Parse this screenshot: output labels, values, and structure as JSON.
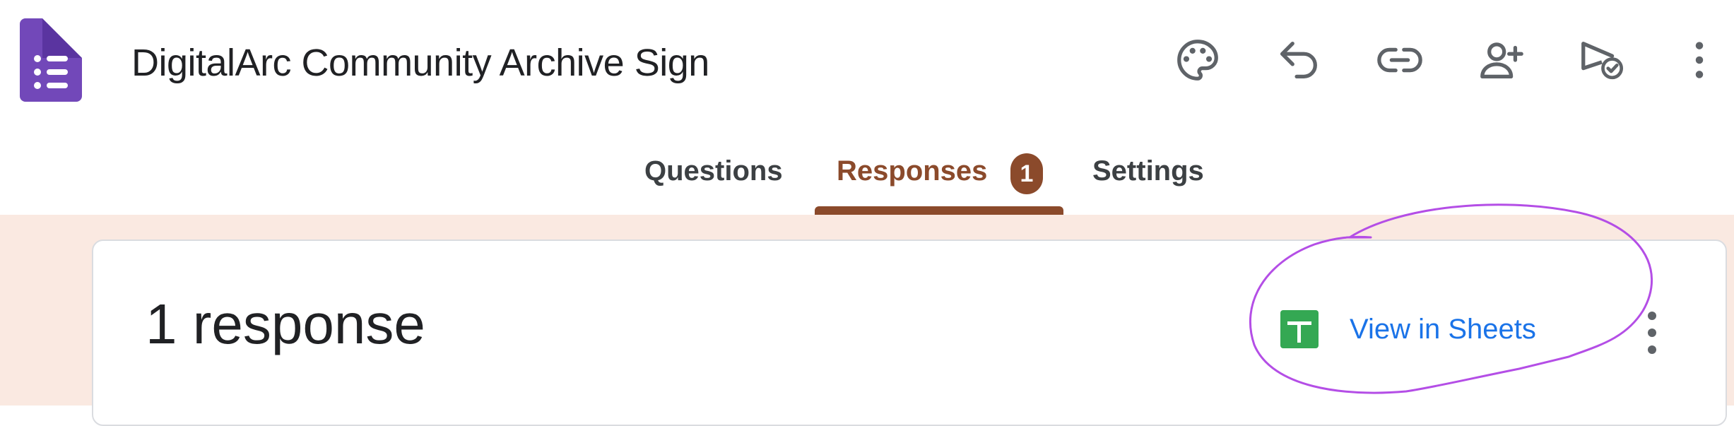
{
  "app": {
    "title": "DigitalArc Community Archive Sign",
    "logo_icon": "google-forms-icon",
    "accent_color": "#7248b9"
  },
  "toolbar": {
    "icons": [
      "palette-icon",
      "undo-icon",
      "link-icon",
      "add-collaborator-icon",
      "send-icon",
      "more-vert-icon"
    ]
  },
  "tabs": [
    {
      "label": "Questions",
      "active": false
    },
    {
      "label": "Responses",
      "active": true,
      "badge": "1"
    },
    {
      "label": "Settings",
      "active": false
    }
  ],
  "responses": {
    "count_label": "1 response",
    "view_in_sheets_label": "View in Sheets",
    "sheets_icon": "google-sheets-icon",
    "menu_icon": "more-vert-icon"
  },
  "theme": {
    "active_tab_color": "#8b4a2b",
    "background_tint": "#fae9e1",
    "annotation_color": "#b44ee6"
  }
}
